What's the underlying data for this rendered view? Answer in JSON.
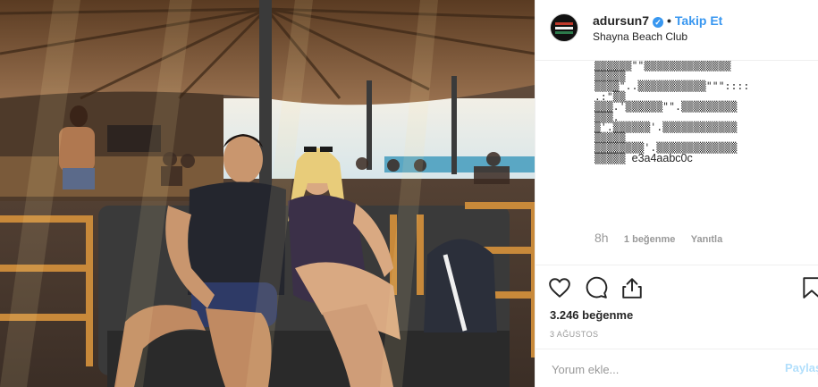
{
  "post": {
    "photo_alt": "",
    "username": "adursun7",
    "verified": true,
    "follow_label": "Takip Et",
    "location": "Shayna Beach Club"
  },
  "comment": {
    "lines": [
      "▒▒▒▒▒▒\"\"▒▒▒▒▒▒▒▒▒▒▒▒▒▒",
      "▒▒▒▒▒",
      "▒▒▒▒\"..▒▒▒▒▒▒▒▒▒▒▒\"\"\"::::",
      ".:\"▒▒",
      "▒▒▒.'▒▒▒▒▒▒\"\".▒▒▒▒▒▒▒▒▒",
      "▒▒▒.",
      "▒'.▒▒▒▒▒▒'.▒▒▒▒▒▒▒▒▒▒▒▒",
      "▒▒▒▒▒",
      "▒▒▒▒▒▒▒▒'.▒▒▒▒▒▒▒▒▒▒▒▒▒",
      "▒▒▒▒▒"
    ],
    "tail": "e3a4aabc0c",
    "time": "8h",
    "likes": "1 beğenme",
    "reply": "Yanıtla"
  },
  "actions": {
    "like_count": "3.246 beğenme",
    "date": "3 AĞUSTOS",
    "icons": [
      "heart-icon",
      "comment-icon",
      "share-icon",
      "bookmark-icon"
    ]
  },
  "comment_box": {
    "placeholder": "Yorum ekle...",
    "post_label": "Paylaş"
  },
  "colors": {
    "link": "#3897f0",
    "muted": "#999999",
    "post_disabled": "#b2dffc"
  }
}
